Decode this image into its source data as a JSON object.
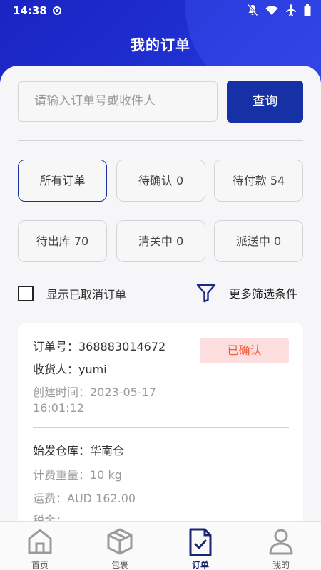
{
  "status_bar": {
    "time": "14:38"
  },
  "header": {
    "title": "我的订单"
  },
  "search": {
    "placeholder": "请输入订单号或收件人",
    "button_label": "查询"
  },
  "filters": [
    {
      "label": "所有订单",
      "active": true
    },
    {
      "label": "待确认 0",
      "active": false
    },
    {
      "label": "待付款 54",
      "active": false
    },
    {
      "label": "待出库 70",
      "active": false
    },
    {
      "label": "清关中 0",
      "active": false
    },
    {
      "label": "派送中 0",
      "active": false
    }
  ],
  "options": {
    "show_cancelled_label": "显示已取消订单",
    "more_filters_label": "更多筛选条件"
  },
  "order": {
    "order_no": "订单号：368883014672",
    "receiver": "收货人：yumi",
    "created_date": "创建时间：2023-05-17",
    "created_time": "16:01:12",
    "status": "已确认",
    "warehouse": "始发仓库：华南仓",
    "weight": "计费重量：10 kg",
    "freight": "运费：AUD 162.00",
    "tax": "税金："
  },
  "bottom_nav": [
    {
      "label": "首页",
      "icon": "home-icon"
    },
    {
      "label": "包裹",
      "icon": "package-icon"
    },
    {
      "label": "订单",
      "icon": "order-icon"
    },
    {
      "label": "我的",
      "icon": "user-icon"
    }
  ],
  "colors": {
    "primary": "#1630a6",
    "header": "#1d2bc7",
    "status_badge_bg": "#fddede",
    "status_badge_text": "#ee5a3a"
  }
}
